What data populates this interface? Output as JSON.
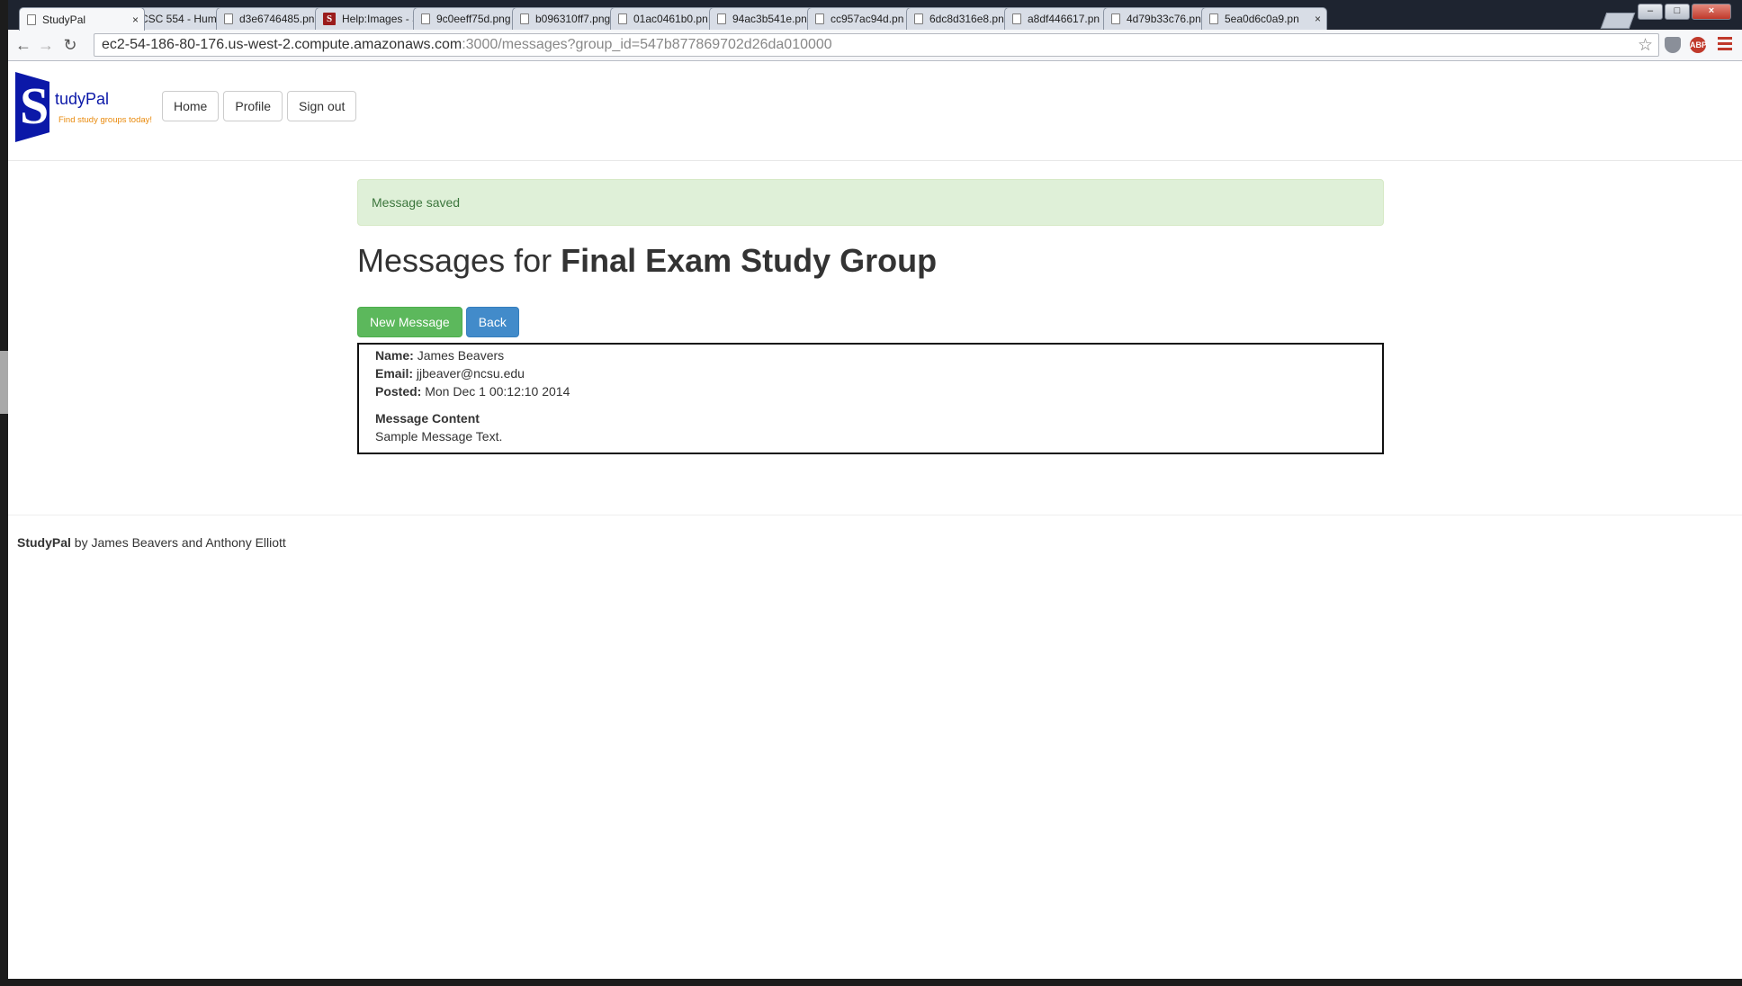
{
  "browser": {
    "tabs": [
      {
        "title": "StudyPal",
        "active": true,
        "favicon": "page-icon"
      },
      {
        "title": "CSC 554 - Hum",
        "active": false,
        "favicon": "page-icon"
      },
      {
        "title": "d3e6746485.pn",
        "active": false,
        "favicon": "page-icon"
      },
      {
        "title": "Help:Images - S",
        "active": false,
        "favicon": "s-icon"
      },
      {
        "title": "9c0eeff75d.png",
        "active": false,
        "favicon": "page-icon"
      },
      {
        "title": "b096310ff7.png",
        "active": false,
        "favicon": "page-icon"
      },
      {
        "title": "01ac0461b0.pn",
        "active": false,
        "favicon": "page-icon"
      },
      {
        "title": "94ac3b541e.pn",
        "active": false,
        "favicon": "page-icon"
      },
      {
        "title": "cc957ac94d.pn",
        "active": false,
        "favicon": "page-icon"
      },
      {
        "title": "6dc8d316e8.pn",
        "active": false,
        "favicon": "page-icon"
      },
      {
        "title": "a8df446617.pn",
        "active": false,
        "favicon": "page-icon"
      },
      {
        "title": "4d79b33c76.pn",
        "active": false,
        "favicon": "page-icon"
      },
      {
        "title": "5ea0d6c0a9.pn",
        "active": false,
        "favicon": "page-icon"
      }
    ],
    "close_glyph": "×",
    "s_favicon_letter": "S",
    "url_host": "ec2-54-186-80-176.us-west-2.compute.amazonaws.com",
    "url_path": ":3000/messages?group_id=547b877869702d26da010000",
    "abp_label": "ABP",
    "window_controls": {
      "minimize": "–",
      "maximize": "□",
      "close": "×"
    }
  },
  "site": {
    "logo_letter": "S",
    "logo_name": "tudyPal",
    "logo_tagline": "Find study groups today!",
    "nav": [
      {
        "label": "Home"
      },
      {
        "label": "Profile"
      },
      {
        "label": "Sign out"
      }
    ]
  },
  "main": {
    "flash": "Message saved",
    "title_prefix": "Messages for ",
    "title_group": "Final Exam Study Group",
    "new_message_label": "New Message",
    "back_label": "Back",
    "message": {
      "name_label": "Name:",
      "name": "James Beavers",
      "email_label": "Email:",
      "email": "jjbeaver@ncsu.edu",
      "posted_label": "Posted:",
      "posted": "Mon Dec 1 00:12:10 2014",
      "content_heading": "Message Content",
      "content": "Sample Message Text."
    }
  },
  "footer": {
    "brand": "StudyPal",
    "credit": " by James Beavers and Anthony Elliott"
  },
  "colors": {
    "flash_bg": "#dff0d8",
    "flash_text": "#3c763d",
    "btn_success": "#5cb85c",
    "btn_primary": "#428bca",
    "logo_blue": "#0b18a8",
    "logo_orange": "#e98a0c"
  }
}
